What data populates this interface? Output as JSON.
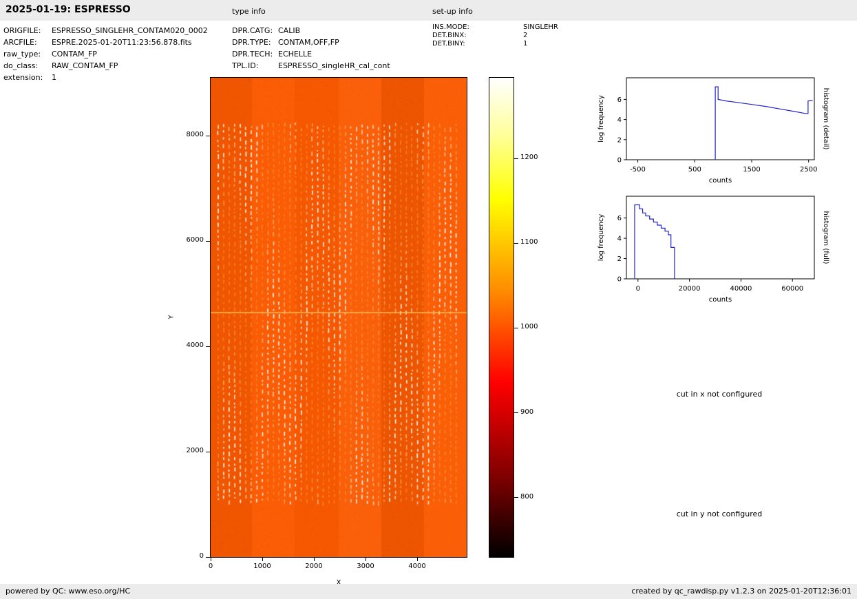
{
  "header": {
    "title": "2025-01-19: ESPRESSO",
    "type_info_label": "type info",
    "setup_info_label": "set-up info"
  },
  "metadata": {
    "left": [
      {
        "label": "ORIGFILE:",
        "value": "ESPRESSO_SINGLEHR_CONTAM020_0002"
      },
      {
        "label": "ARCFILE:",
        "value": "ESPRE.2025-01-20T11:23:56.878.fits"
      },
      {
        "label": "raw_type:",
        "value": "CONTAM_FP"
      },
      {
        "label": "do_class:",
        "value": "RAW_CONTAM_FP"
      },
      {
        "label": "extension:",
        "value": "1"
      }
    ],
    "type_info": [
      {
        "label": "DPR.CATG:",
        "value": "CALIB"
      },
      {
        "label": "DPR.TYPE:",
        "value": "CONTAM,OFF,FP"
      },
      {
        "label": "DPR.TECH:",
        "value": "ECHELLE"
      },
      {
        "label": "TPL.ID:",
        "value": "ESPRESSO_singleHR_cal_cont"
      }
    ],
    "setup_info": [
      {
        "label": "INS.MODE:",
        "value": "SINGLEHR"
      },
      {
        "label": "DET.BINX:",
        "value": "2"
      },
      {
        "label": "DET.BINY:",
        "value": "1"
      }
    ]
  },
  "messages": {
    "cut_x": "cut in x not configured",
    "cut_y": "cut in y not configured"
  },
  "footer": {
    "left": "powered by QC: www.eso.org/HC",
    "right": "created by qc_rawdisp.py v1.2.3 on 2025-01-20T12:36:01"
  },
  "colors": {
    "hist_line": "#2222cc",
    "image_base": "#fa5a00",
    "bar_bg": "#ececec"
  },
  "chart_data": [
    {
      "id": "histogram_detail",
      "type": "line",
      "title": "histogram (detail)",
      "xlabel": "counts",
      "ylabel": "log frequency",
      "xlim": [
        -700,
        2600
      ],
      "ylim": [
        0,
        8.15
      ],
      "x_ticks": [
        -500,
        500,
        1500,
        2500
      ],
      "y_ticks": [
        0,
        2,
        4,
        6
      ],
      "line_color": "#2222cc",
      "points": [
        [
          860,
          0
        ],
        [
          860,
          7.25
        ],
        [
          910,
          7.25
        ],
        [
          910,
          6.0
        ],
        [
          1050,
          5.85
        ],
        [
          1250,
          5.7
        ],
        [
          1500,
          5.5
        ],
        [
          1750,
          5.3
        ],
        [
          2000,
          5.05
        ],
        [
          2250,
          4.8
        ],
        [
          2440,
          4.6
        ],
        [
          2490,
          4.6
        ],
        [
          2490,
          5.85
        ],
        [
          2570,
          5.9
        ]
      ]
    },
    {
      "id": "histogram_full",
      "type": "line",
      "title": "histogram (full)",
      "xlabel": "counts",
      "ylabel": "log frequency",
      "xlim": [
        -4500,
        68500
      ],
      "ylim": [
        0,
        8.15
      ],
      "x_ticks": [
        0,
        20000,
        40000,
        60000
      ],
      "y_ticks": [
        0,
        2,
        4,
        6
      ],
      "line_color": "#2222cc",
      "points": [
        [
          -1300,
          0
        ],
        [
          -1300,
          7.3
        ],
        [
          600,
          7.3
        ],
        [
          600,
          6.9
        ],
        [
          1800,
          6.9
        ],
        [
          1800,
          6.5
        ],
        [
          3000,
          6.5
        ],
        [
          3000,
          6.2
        ],
        [
          4500,
          6.2
        ],
        [
          4500,
          5.9
        ],
        [
          6000,
          5.9
        ],
        [
          6000,
          5.6
        ],
        [
          7500,
          5.6
        ],
        [
          7500,
          5.3
        ],
        [
          9000,
          5.3
        ],
        [
          9000,
          5.0
        ],
        [
          10500,
          5.0
        ],
        [
          10500,
          4.7
        ],
        [
          11800,
          4.7
        ],
        [
          11800,
          4.35
        ],
        [
          12800,
          4.35
        ],
        [
          12800,
          3.1
        ],
        [
          14200,
          3.1
        ],
        [
          14200,
          0
        ]
      ]
    },
    {
      "id": "raw_detector_image",
      "type": "heatmap",
      "xlabel": "X",
      "ylabel": "Y",
      "xlim": [
        0,
        4960
      ],
      "ylim": [
        0,
        9100
      ],
      "x_ticks": [
        0,
        1000,
        2000,
        3000,
        4000
      ],
      "y_ticks": [
        0,
        2000,
        4000,
        6000,
        8000
      ],
      "colorbar": {
        "ticks": [
          1200,
          1100,
          1000,
          900,
          800
        ],
        "vmin": 730,
        "vmax": 1295,
        "colormap": "hot"
      },
      "image": {
        "background_value": 1000,
        "order_y_min": 1050,
        "order_y_max": 8250,
        "bright_line_y": 4650,
        "n_order_columns": 44
      }
    }
  ]
}
